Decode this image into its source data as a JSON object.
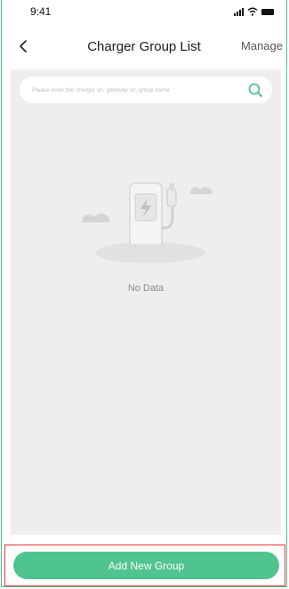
{
  "status_bar": {
    "time": "9:41"
  },
  "header": {
    "title": "Charger Group List",
    "manage_label": "Manage"
  },
  "search": {
    "placeholder": "Please enter the charger sn, gateway sn, group name"
  },
  "empty_state": {
    "message": "No Data",
    "illustration_icon": "charging-station-icon"
  },
  "footer": {
    "add_button_label": "Add New Group"
  },
  "colors": {
    "accent": "#4fc48f",
    "background": "#eeeeef",
    "highlight_border": "#e5383b"
  }
}
